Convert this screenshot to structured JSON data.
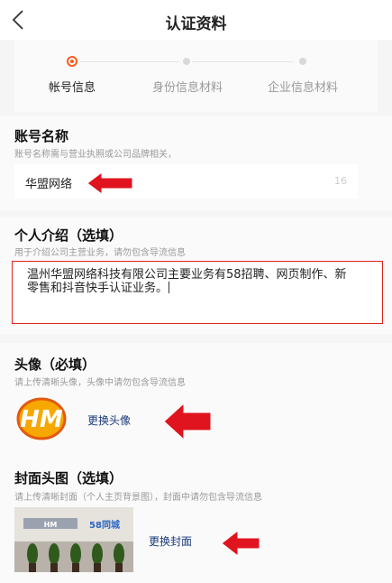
{
  "nav": {
    "title": "认证资料"
  },
  "steps": [
    {
      "label": "帐号信息",
      "active": true
    },
    {
      "label": "身份信息材料",
      "active": false
    },
    {
      "label": "企业信息材料",
      "active": false
    }
  ],
  "account": {
    "title": "账号名称",
    "hint": "账号名称需与营业执照或公司品牌相关，",
    "value": "华盟网络",
    "counter": "16"
  },
  "intro": {
    "title": "个人介绍（选填）",
    "hint": "用于介绍公司主营业务，请勿包含导流信息",
    "value": "温州华盟网络科技有限公司主要业务有58招聘、网页制作、新零售和抖音快手认证业务。"
  },
  "avatar": {
    "title": "头像（必填）",
    "hint": "请上传清晰头像，头像中请勿包含导流信息",
    "logo_text": "HM",
    "change_label": "更换头像"
  },
  "cover": {
    "title": "封面头图（选填）",
    "hint": "请上传清晰封面（个人主页背景图），封面中请勿包含导流信息",
    "sign_text": "58同城",
    "change_label": "更换封面"
  },
  "colors": {
    "accent": "#ff5a1f",
    "arrow": "#e0141e",
    "link": "#1a3a7a",
    "highlight_border": "#d9261c"
  }
}
